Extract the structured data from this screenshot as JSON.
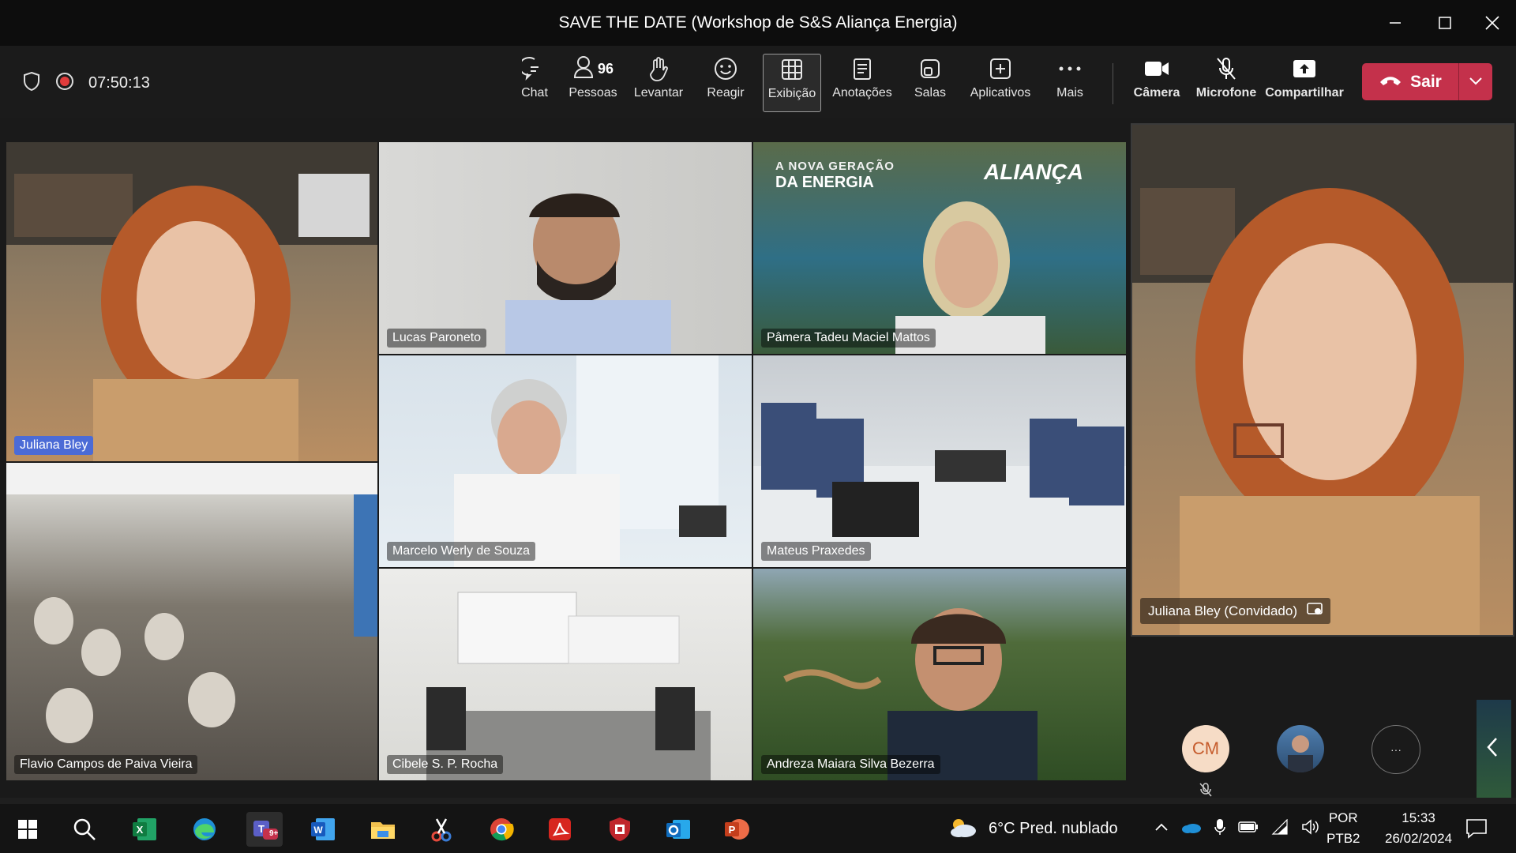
{
  "window": {
    "title": "SAVE THE DATE (Workshop de S&S Aliança Energia)"
  },
  "toolbar": {
    "timer": "07:50:13",
    "people_count": "96",
    "buttons": {
      "chat": "Chat",
      "people": "Pessoas",
      "raise": "Levantar",
      "react": "Reagir",
      "view": "Exibição",
      "notes": "Anotações",
      "rooms": "Salas",
      "apps": "Aplicativos",
      "more": "Mais",
      "camera": "Câmera",
      "mic": "Microfone",
      "share": "Compartilhar"
    },
    "leave_label": "Sair",
    "leave_color": "#c4314b"
  },
  "participants": [
    {
      "name": "Juliana Bley"
    },
    {
      "name": "Lucas Paroneto"
    },
    {
      "name": "Pâmera Tadeu Maciel Mattos"
    },
    {
      "name": "Flavio Campos de Paiva Vieira"
    },
    {
      "name": "Marcelo Werly de Souza"
    },
    {
      "name": "Mateus Praxedes"
    },
    {
      "name": "Cibele S. P. Rocha"
    },
    {
      "name": "Andreza Maiara Silva Bezerra"
    }
  ],
  "banner": {
    "line1": "A NOVA GERAÇÃO",
    "line2": "DA ENERGIA",
    "brand": "ALIANÇA"
  },
  "spotlight": {
    "name": "Juliana Bley (Convidado)"
  },
  "roster": {
    "initials": "CM",
    "more": "···"
  },
  "taskbar": {
    "weather": "6°C  Pred. nublado",
    "lang1": "POR",
    "lang2": "PTB2",
    "time": "15:33",
    "date": "26/02/2024",
    "teams_badge": "9+",
    "apps": [
      "start-icon",
      "search-icon",
      "excel-icon",
      "edge-icon",
      "teams-icon",
      "word-icon",
      "file-explorer-icon",
      "snipping-tool-icon",
      "chrome-icon",
      "acrobat-icon",
      "security-icon",
      "outlook-icon",
      "powerpoint-icon"
    ]
  }
}
